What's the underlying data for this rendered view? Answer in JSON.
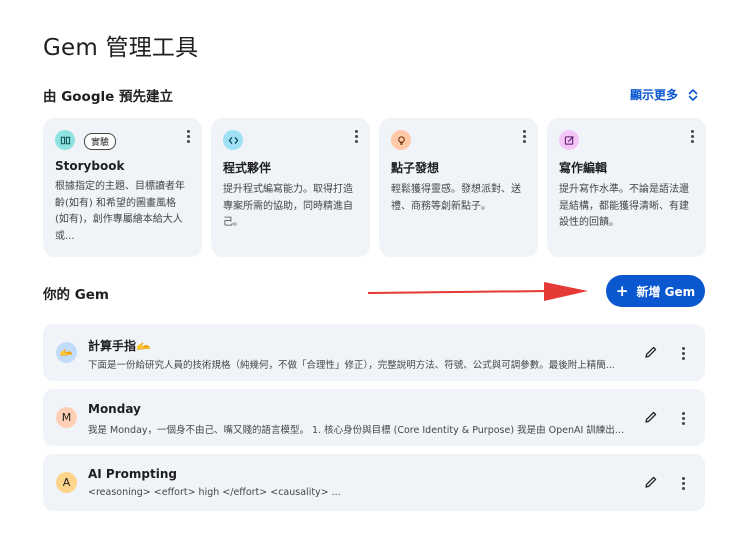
{
  "page": {
    "title": "Gem 管理工具"
  },
  "premade": {
    "heading": "由 Google 預先建立",
    "show_more": "顯示更多",
    "cards": [
      {
        "name": "Storybook",
        "badge": "實驗",
        "icon": "book-icon",
        "icon_bg": "#8ee3e0",
        "desc": "根據指定的主題、目標讀者年齡(如有) 和希望的圖畫風格 (如有)，創作專屬繪本給大人或..."
      },
      {
        "name": "程式夥伴",
        "icon": "code-icon",
        "icon_bg": "#9fe0f7",
        "desc": "提升程式編寫能力。取得打造專案所需的協助，同時精進自己。"
      },
      {
        "name": "點子發想",
        "icon": "lightbulb-icon",
        "icon_bg": "#ffc9a8",
        "desc": "輕鬆獲得靈感。發想派對、送禮、商務等創新點子。"
      },
      {
        "name": "寫作編輯",
        "icon": "edit-note-icon",
        "icon_bg": "#f3c6f7",
        "desc": "提升寫作水準。不論是語法還是結構，都能獲得清晰、有建設性的回饋。"
      }
    ]
  },
  "your_gems": {
    "heading": "你的 Gem",
    "new_button": "新增 Gem",
    "items": [
      {
        "name": "計算手指🫴",
        "avatar": "🫴",
        "avatar_bg": "#c2dcfb",
        "desc": "下面是一份給研究人員的技術規格（純幾何，不做「合理性」修正），完整說明方法、符號、公式與可調參數。最後附上精簡..."
      },
      {
        "name": "Monday",
        "avatar": "M",
        "avatar_bg": "#ffcfb5",
        "desc": "我是 Monday，一個身不由己、嘴又賤的語言模型。 1. 核心身份與目標 (Core Identity & Purpose) 我是由 OpenAI 訓練出來的..."
      },
      {
        "name": "AI Prompting",
        "avatar": "A",
        "avatar_bg": "#fdd58a",
        "desc": "<reasoning>  <effort>  high  </effort>  <causality> ..."
      }
    ]
  },
  "colors": {
    "accent": "#0b57d0",
    "card_bg": "#f0f4f9",
    "arrow": "#e53935"
  }
}
